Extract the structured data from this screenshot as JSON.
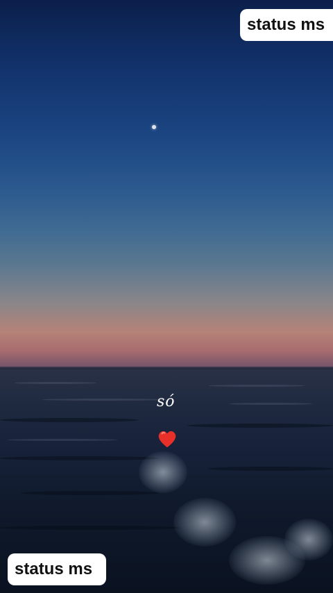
{
  "overlay": {
    "top_badge": "status ms",
    "bottom_badge": "status ms"
  },
  "caption": {
    "text": "só",
    "emoji_icon": "red-heart-icon",
    "heart_color": "#e8302a"
  },
  "icons": {
    "moon": "moon-icon"
  }
}
